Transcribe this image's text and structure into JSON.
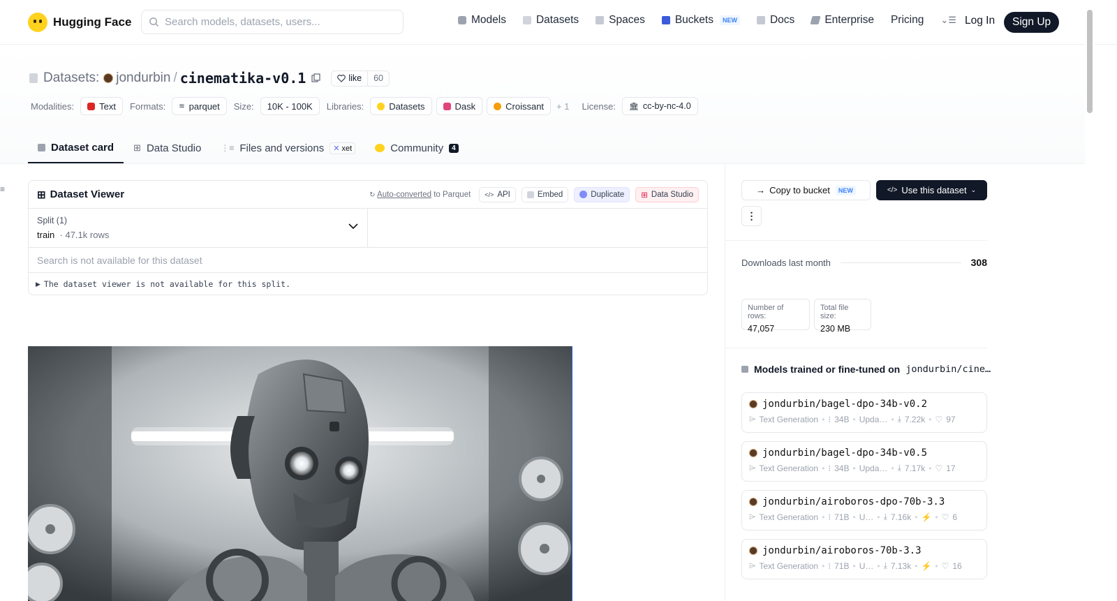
{
  "nav": {
    "brand": "Hugging Face",
    "search_placeholder": "Search models, datasets, users...",
    "links": [
      {
        "label": "Models",
        "icon": "models-icon"
      },
      {
        "label": "Datasets",
        "icon": "datasets-icon"
      },
      {
        "label": "Spaces",
        "icon": "spaces-icon"
      },
      {
        "label": "Buckets",
        "icon": "buckets-icon",
        "badge": "NEW"
      },
      {
        "label": "Docs",
        "icon": "docs-icon"
      },
      {
        "label": "Enterprise",
        "icon": "enterprise-icon"
      },
      {
        "label": "Pricing"
      }
    ],
    "login": "Log In",
    "signup": "Sign Up"
  },
  "repo": {
    "type_label": "Datasets:",
    "owner": "jondurbin",
    "separator": "/",
    "name": "cinematika-v0.1",
    "like_label": "like",
    "likes": "60"
  },
  "meta": {
    "modalities_label": "Modalities:",
    "modality": "Text",
    "formats_label": "Formats:",
    "format": "parquet",
    "size_label": "Size:",
    "size": "10K - 100K",
    "libraries_label": "Libraries:",
    "libraries": [
      "Datasets",
      "Dask",
      "Croissant"
    ],
    "libraries_more": "+ 1",
    "license_label": "License:",
    "license": "cc-by-nc-4.0"
  },
  "tabs": {
    "card": "Dataset card",
    "studio": "Data Studio",
    "files": "Files and versions",
    "xet": "xet",
    "community": "Community",
    "community_count": "4"
  },
  "viewer": {
    "title": "Dataset Viewer",
    "auto_converted": "Auto-converted",
    "to_parquet": " to Parquet",
    "api": "API",
    "embed": "Embed",
    "duplicate": "Duplicate",
    "data_studio": "Data Studio",
    "split_label": "Split (1)",
    "split_name": "train",
    "split_rows": "· 47.1k rows",
    "search_msg": "Search is not available for this dataset",
    "not_available": "The dataset viewer is not available for this split."
  },
  "side": {
    "copy_bucket": "Copy to bucket",
    "new_badge": "NEW",
    "use_dataset": "Use this dataset",
    "downloads_label": "Downloads last month",
    "downloads": "308",
    "rows_label": "Number of rows:",
    "rows": "47,057",
    "filesize_label": "Total file size:",
    "filesize": "230 MB",
    "models_heading": "Models trained or fine-tuned on",
    "models_heading_repo": "jondurbin/cine…",
    "models": [
      {
        "name": "jondurbin/bagel-dpo-34b-v0.2",
        "task": "Text Generation",
        "params": "34B",
        "updated": "Upda…",
        "downloads": "7.22k",
        "likes": "97",
        "bolt": false
      },
      {
        "name": "jondurbin/bagel-dpo-34b-v0.5",
        "task": "Text Generation",
        "params": "34B",
        "updated": "Upda…",
        "downloads": "7.17k",
        "likes": "17",
        "bolt": false
      },
      {
        "name": "jondurbin/airoboros-dpo-70b-3.3",
        "task": "Text Generation",
        "params": "71B",
        "updated": "U…",
        "downloads": "7.16k",
        "likes": "6",
        "bolt": true
      },
      {
        "name": "jondurbin/airoboros-70b-3.3",
        "task": "Text Generation",
        "params": "71B",
        "updated": "U…",
        "downloads": "7.13k",
        "likes": "16",
        "bolt": true
      }
    ]
  }
}
